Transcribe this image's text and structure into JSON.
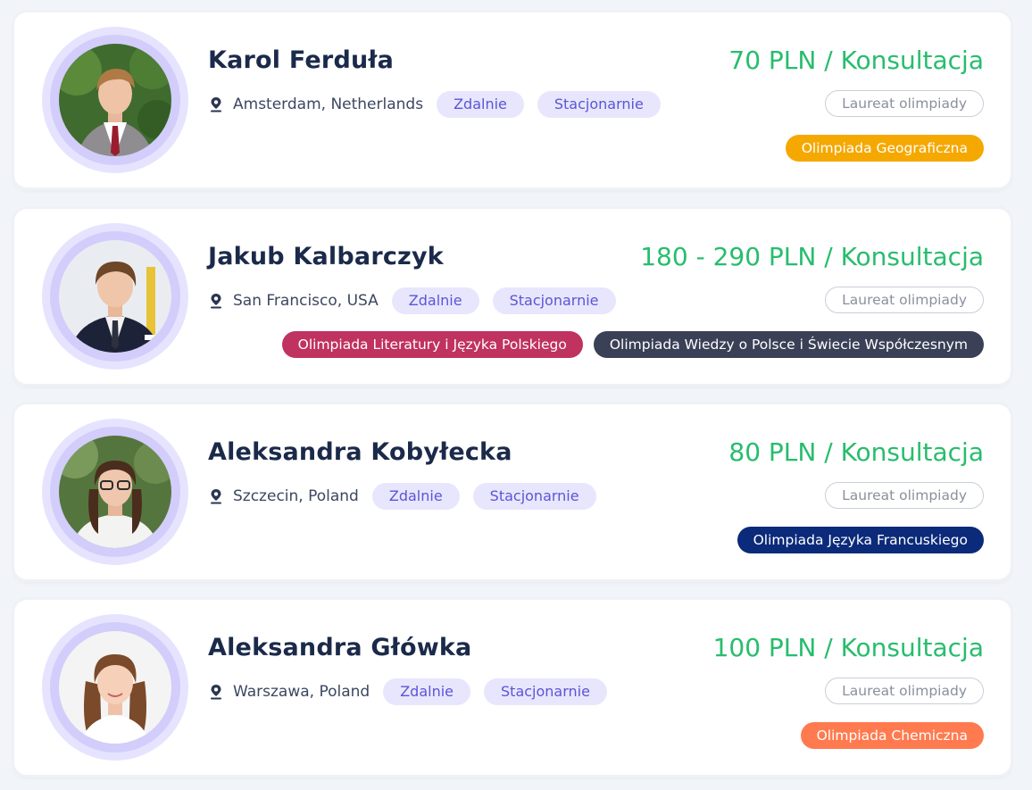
{
  "tutors": [
    {
      "name": "Karol Ferduła",
      "price": "70 PLN / Konsultacja",
      "location": "Amsterdam, Netherlands",
      "modes": [
        "Zdalnie",
        "Stacjonarnie"
      ],
      "badge": "Laureat olimpiady",
      "olympiads": [
        {
          "label": "Olimpiada Geograficzna",
          "color": "#f5a800"
        }
      ]
    },
    {
      "name": "Jakub Kalbarczyk",
      "price": "180 - 290 PLN / Konsultacja",
      "location": "San Francisco, USA",
      "modes": [
        "Zdalnie",
        "Stacjonarnie"
      ],
      "badge": "Laureat olimpiady",
      "olympiads": [
        {
          "label": "Olimpiada Literatury i Języka Polskiego",
          "color": "#c0325f"
        },
        {
          "label": "Olimpiada Wiedzy o Polsce i Świecie Współczesnym",
          "color": "#3a4157"
        }
      ]
    },
    {
      "name": "Aleksandra Kobyłecka",
      "price": "80 PLN / Konsultacja",
      "location": "Szczecin, Poland",
      "modes": [
        "Zdalnie",
        "Stacjonarnie"
      ],
      "badge": "Laureat olimpiady",
      "olympiads": [
        {
          "label": "Olimpiada Języka Francuskiego",
          "color": "#0b2a7a"
        }
      ]
    },
    {
      "name": "Aleksandra Główka",
      "price": "100 PLN / Konsultacja",
      "location": "Warszawa, Poland",
      "modes": [
        "Zdalnie",
        "Stacjonarnie"
      ],
      "badge": "Laureat olimpiady",
      "olympiads": [
        {
          "label": "Olimpiada Chemiczna",
          "color": "#ff7b4f"
        }
      ]
    }
  ],
  "colors": {
    "price": "#27bd6d",
    "name": "#1b2a4a",
    "mode_bg": "#e8e6fd",
    "mode_text": "#5b55d6",
    "avatar_ring": "#e6e3ff"
  },
  "icons": {
    "location": "map-pin-icon"
  }
}
